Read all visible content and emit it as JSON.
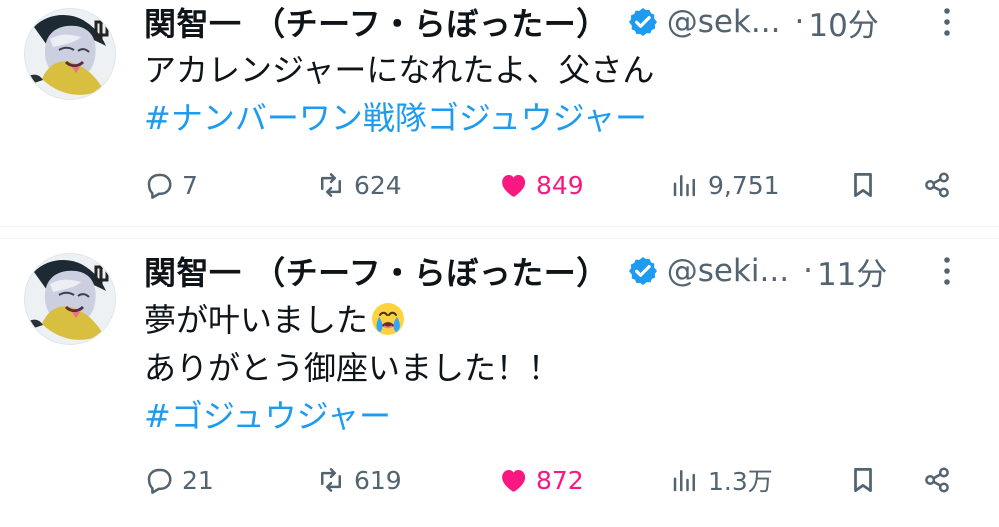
{
  "colors": {
    "text": "#0f1419",
    "secondary": "#536471",
    "hashtag": "#1d9bf0",
    "like": "#f91880",
    "verified": "#1d9bf0"
  },
  "icons": [
    "verified-badge-icon",
    "more-dots-icon",
    "reply-icon",
    "retweet-icon",
    "heart-icon",
    "views-icon",
    "bookmark-icon",
    "share-icon",
    "crying-emoji-icon"
  ],
  "tweets": [
    {
      "author": {
        "name": "関智一 （チーフ・らぼったー）",
        "handle": "@sek...",
        "verified": true
      },
      "separator": "·",
      "timestamp": "10分",
      "lines": [
        "アカレンジャーになれたよ、父さん",
        "#ナンバーワン戦隊ゴジュウジャー"
      ],
      "metrics": {
        "replies": "7",
        "retweets": "624",
        "likes": "849",
        "views": "9,751"
      }
    },
    {
      "author": {
        "name": "関智一 （チーフ・らぼったー）",
        "handle": "@seki...",
        "verified": true
      },
      "separator": "·",
      "timestamp": "11分",
      "lines": [
        "夢が叶いました",
        "ありがとう御座いました！！",
        "#ゴジュウジャー"
      ],
      "metrics": {
        "replies": "21",
        "retweets": "619",
        "likes": "872",
        "views": "1.3万"
      }
    }
  ]
}
